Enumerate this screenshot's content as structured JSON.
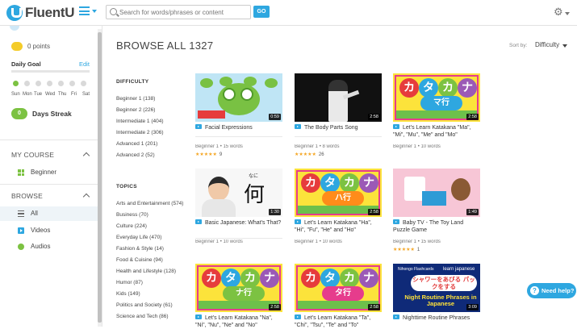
{
  "header": {
    "logo_text": "FluentU",
    "search_placeholder": "Search for words/phrases or content",
    "go_label": "GO",
    "settings_icon": "gear-icon",
    "menu_icon": "hamburger-icon"
  },
  "sidebar": {
    "points": "0 points",
    "daily_goal_label": "Daily Goal",
    "edit_label": "Edit",
    "days": [
      "Sun",
      "Mon",
      "Tue",
      "Wed",
      "Thu",
      "Fri",
      "Sat"
    ],
    "streak_count": "0",
    "streak_label": "Days Streak",
    "my_course": {
      "heading": "MY COURSE",
      "items": [
        {
          "label": "Beginner",
          "icon": "grid-icon"
        }
      ]
    },
    "browse": {
      "heading": "BROWSE",
      "items": [
        {
          "label": "All",
          "icon": "list-icon",
          "active": true
        },
        {
          "label": "Videos",
          "icon": "video-icon"
        },
        {
          "label": "Audios",
          "icon": "audio-icon"
        }
      ]
    }
  },
  "main": {
    "title": "BROWSE ALL 1327",
    "sort_by_label": "Sort by:",
    "sort_value": "Difficulty"
  },
  "filters": {
    "difficulty": {
      "heading": "DIFFICULTY",
      "items": [
        "Beginner 1 (138)",
        "Beginner 2 (226)",
        "Intermediate 1 (404)",
        "Intermediate 2 (306)",
        "Advanced 1 (201)",
        "Advanced 2 (52)"
      ]
    },
    "topics": {
      "heading": "TOPICS",
      "items": [
        "Arts and Entertainment (574)",
        "Business (70)",
        "Culture (224)",
        "Everyday Life (470)",
        "Fashion & Style (14)",
        "Food & Cuisine (94)",
        "Health and Lifestyle (128)",
        "Humor (87)",
        "Kids (149)",
        "Politics and Society (61)",
        "Science and Tech (86)"
      ]
    }
  },
  "cards": [
    {
      "title": "Facial Expressions",
      "duration": "0:59",
      "level": "Beginner 1",
      "words": "15 words",
      "stars": "★★★★★",
      "rating_count": "9"
    },
    {
      "title": "The Body Parts Song",
      "duration": "2:58",
      "level": "Beginner 1",
      "words": "8 words",
      "stars": "★★★★★",
      "rating_count": "26"
    },
    {
      "title": "Let's Learn Katakana \"Ma\", \"Mi\", \"Mu\", \"Me\" and \"Mo\"",
      "duration": "2:58",
      "level": "Beginner 1",
      "words": "10 words",
      "kana": [
        "カ",
        "タ",
        "カ",
        "ナ"
      ],
      "banner": "マ行"
    },
    {
      "title": "Basic Japanese: What's That?",
      "duration": "1:30",
      "level": "Beginner 1",
      "words": "10 words",
      "kanji": "何",
      "furigana": "なに"
    },
    {
      "title": "Let's Learn Katakana \"Ha\", \"Hi\", \"Fu\", \"He\" and \"Ho\"",
      "duration": "2:58",
      "level": "Beginner 1",
      "words": "10 words",
      "kana": [
        "カ",
        "タ",
        "カ",
        "ナ"
      ],
      "banner": "ハ行"
    },
    {
      "title": "Baby TV - The Toy Land Puzzle Game",
      "duration": "1:49",
      "level": "Beginner 1",
      "words": "15 words",
      "stars": "★★★★★",
      "rating_count": "1"
    },
    {
      "title": "Let's Learn Katakana \"Na\", \"Ni\", \"Nu\", \"Ne\" and \"No\"",
      "duration": "2:58",
      "kana": [
        "カ",
        "タ",
        "カ",
        "ナ"
      ],
      "banner": "ナ行"
    },
    {
      "title": "Let's Learn Katakana \"Ta\", \"Chi\", \"Tsu\", \"Te\" and \"To\"",
      "duration": "2:58",
      "kana": [
        "カ",
        "タ",
        "カ",
        "ナ"
      ],
      "banner": "タ行"
    },
    {
      "title": "Nighttime Routine Phrases",
      "duration": "3:09",
      "thumb_top_left": "Nihongo Flashcards",
      "thumb_top_right": "learn japanese",
      "thumb_jp": "シャワーをあびる パックをする",
      "thumb_en": "Night Routine Phrases in Japanese"
    }
  ],
  "help_label": "Need help?",
  "colors": {
    "accent": "#2ea7e0",
    "green": "#7cc242",
    "star": "#f5a623",
    "kata_bg": "#fce33b"
  }
}
